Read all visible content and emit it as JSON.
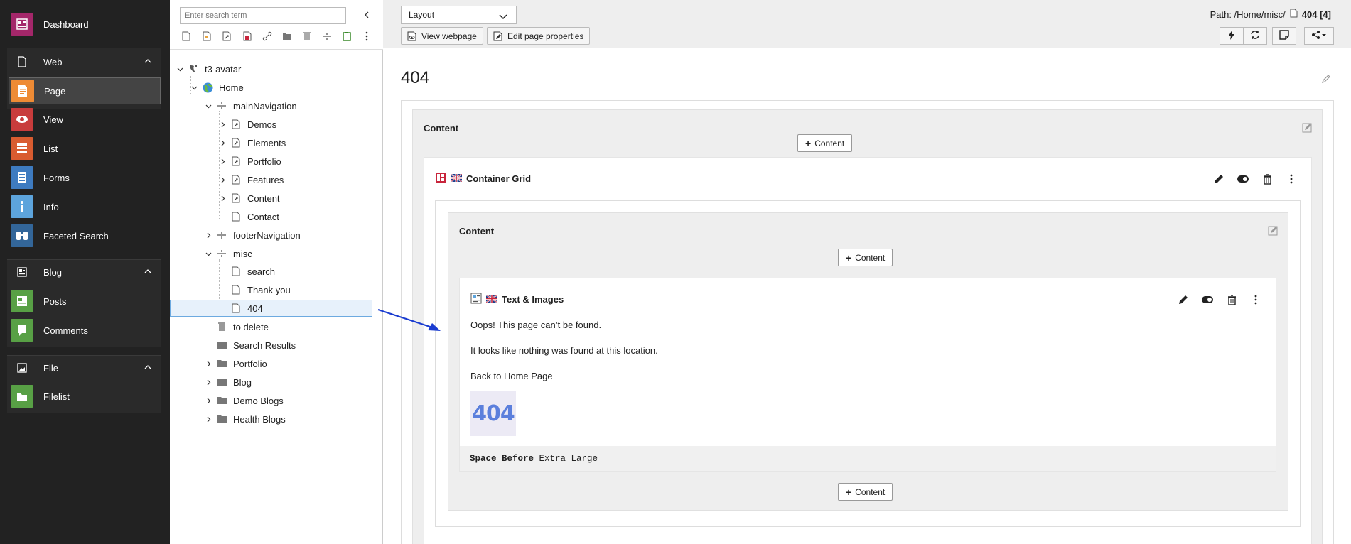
{
  "module_menu": {
    "items": [
      {
        "label": "Dashboard",
        "color": "#a4276a"
      },
      {
        "group": "Web"
      },
      {
        "label": "Page",
        "color": "#ee8b35",
        "active": true
      },
      {
        "label": "View",
        "color": "#c83c3c"
      },
      {
        "label": "List",
        "color": "#d95c30"
      },
      {
        "label": "Forms",
        "color": "#3e7bc0"
      },
      {
        "label": "Info",
        "color": "#5da4dc"
      },
      {
        "label": "Faceted Search",
        "color": "#369"
      },
      {
        "group": "Blog"
      },
      {
        "label": "Posts",
        "color": "#58a045"
      },
      {
        "label": "Comments",
        "color": "#58a045"
      },
      {
        "group": "File"
      },
      {
        "label": "Filelist",
        "color": "#58a045"
      }
    ],
    "dashboard": "Dashboard",
    "web": "Web",
    "page": "Page",
    "view": "View",
    "list": "List",
    "forms": "Forms",
    "info": "Info",
    "faceted_search": "Faceted Search",
    "blog": "Blog",
    "posts": "Posts",
    "comments": "Comments",
    "file": "File",
    "filelist": "Filelist"
  },
  "tree": {
    "search_placeholder": "Enter search term",
    "root": "t3-avatar",
    "home": "Home",
    "main_navigation": "mainNavigation",
    "demos": "Demos",
    "elements": "Elements",
    "portfolio_sub": "Portfolio",
    "features": "Features",
    "content": "Content",
    "contact": "Contact",
    "footer_navigation": "footerNavigation",
    "misc": "misc",
    "search": "search",
    "thank_you": "Thank you",
    "p404": "404",
    "to_delete": "to delete",
    "search_results": "Search Results",
    "portfolio": "Portfolio",
    "blog": "Blog",
    "demo_blogs": "Demo Blogs",
    "health_blogs": "Health Blogs"
  },
  "docheader": {
    "layout_select": "Layout",
    "view_webpage": "View webpage",
    "edit_page_properties": "Edit page properties",
    "path_label": "Path: /Home/misc/",
    "path_page": "404 [4]"
  },
  "content": {
    "page_title": "404",
    "col_content": "Content",
    "add_content": "Content",
    "container_grid": "Container Grid",
    "inner_col": "Content",
    "text_images": "Text & Images",
    "line1": "Oops! This page can’t be found.",
    "line2": "It looks like nothing was found at this location.",
    "line3": "Back to Home Page",
    "image_text": "404",
    "footer_key": "Space Before",
    "footer_value": "Extra Large"
  }
}
